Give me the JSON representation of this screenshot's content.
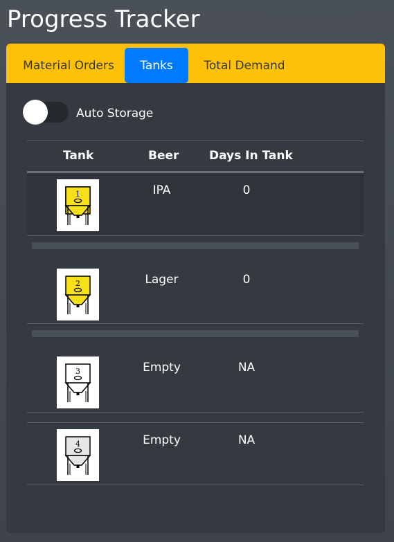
{
  "page": {
    "title": "Progress Tracker"
  },
  "tabs": [
    {
      "label": "Material Orders",
      "active": false
    },
    {
      "label": "Tanks",
      "active": true
    },
    {
      "label": "Total Demand",
      "active": false
    }
  ],
  "auto_storage": {
    "label": "Auto Storage",
    "enabled": false
  },
  "table": {
    "headers": [
      "Tank",
      "Beer",
      "Days In Tank"
    ],
    "rows": [
      {
        "tank": "1",
        "beer": "IPA",
        "days": "0",
        "fill_color": "#f5e01a",
        "progress": 0
      },
      {
        "tank": "2",
        "beer": "Lager",
        "days": "0",
        "fill_color": "#f5e01a",
        "progress": 0
      },
      {
        "tank": "3",
        "beer": "Empty",
        "days": "NA",
        "fill_color": "#ffffff"
      },
      {
        "tank": "4",
        "beer": "Empty",
        "days": "NA",
        "fill_color": "#e6e6e6"
      }
    ]
  },
  "colors": {
    "tab_bar": "#ffc107",
    "active_tab": "#007bff",
    "panel": "#343a40"
  },
  "icons": {
    "tank": "fermenter-tank-icon"
  }
}
